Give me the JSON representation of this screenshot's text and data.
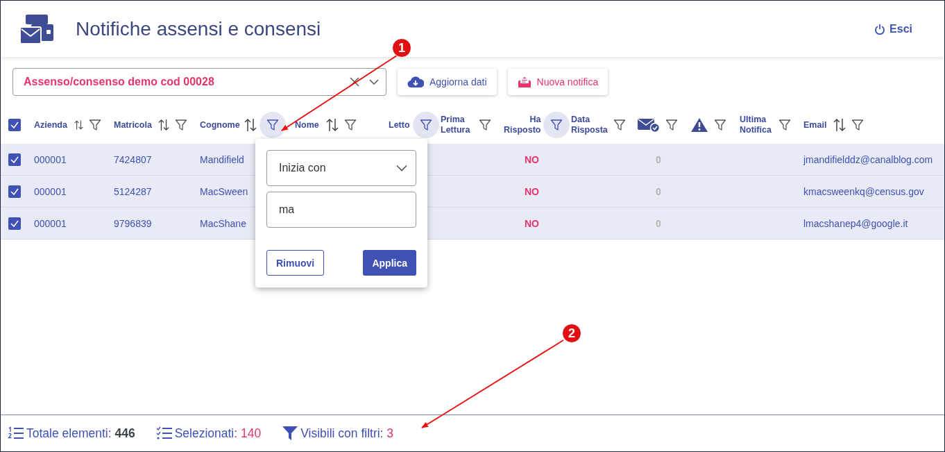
{
  "header": {
    "title": "Notifiche assensi e consensi",
    "logout": "Esci"
  },
  "toolbar": {
    "selector": {
      "value": "Assenso/consenso demo cod 00028"
    },
    "buttons": [
      {
        "label": "Aggiorna dati",
        "kind": "refresh"
      },
      {
        "label": "Nuova notifica",
        "kind": "new"
      }
    ]
  },
  "table": {
    "all_checked": true,
    "columns": [
      {
        "kind": "text",
        "label": "Azienda",
        "sortable": true,
        "filter_active": false
      },
      {
        "kind": "text",
        "label": "Matricola",
        "sortable": true,
        "filter_active": false
      },
      {
        "kind": "text",
        "label": "Cognome",
        "sortable": true,
        "filter_active": true
      },
      {
        "kind": "text",
        "label": "Nome",
        "sortable": true,
        "filter_active": false
      },
      {
        "kind": "text",
        "label": "Letto",
        "sortable": false,
        "filter_active": true
      },
      {
        "kind": "text",
        "label": "Prima Lettura",
        "sortable": false,
        "filter_active": false
      },
      {
        "kind": "text",
        "label": "Ha Risposto",
        "sortable": false,
        "filter_active": true
      },
      {
        "kind": "text",
        "label": "Data Risposta",
        "sortable": false,
        "filter_active": false
      },
      {
        "kind": "mail",
        "sortable": false,
        "filter_active": false
      },
      {
        "kind": "warning",
        "sortable": false,
        "filter_active": false
      },
      {
        "kind": "text",
        "label": "Ultima Notifica",
        "sortable": false,
        "filter_active": false
      },
      {
        "kind": "text",
        "label": "Email",
        "sortable": true,
        "filter_active": false
      }
    ],
    "rows": [
      {
        "checked": true,
        "azienda": "000001",
        "matricola": "7424807",
        "cognome": "Mandifield",
        "ha_risposto": "NO",
        "notifiche": "0",
        "email": "jmandifielddz@canalblog.com"
      },
      {
        "checked": true,
        "azienda": "000001",
        "matricola": "5124287",
        "cognome": "MacSween",
        "ha_risposto": "NO",
        "notifiche": "0",
        "email": "kmacsweenkq@census.gov"
      },
      {
        "checked": true,
        "azienda": "000001",
        "matricola": "9796839",
        "cognome": "MacShane",
        "ha_risposto": "NO",
        "notifiche": "0",
        "email": "lmacshanep4@google.it"
      }
    ]
  },
  "filter_popup": {
    "operator": "Inizia con",
    "value": "ma",
    "buttons": [
      "Rimuovi",
      "Applica"
    ]
  },
  "footer": [
    {
      "kind": "total",
      "label": "Totale elementi:",
      "value": "446"
    },
    {
      "kind": "selected",
      "label": "Selezionati:",
      "value": "140"
    },
    {
      "kind": "filtered",
      "label": "Visibili con filtri:",
      "value": "3"
    }
  ],
  "annotations": [
    {
      "number": "1"
    },
    {
      "number": "2"
    }
  ]
}
